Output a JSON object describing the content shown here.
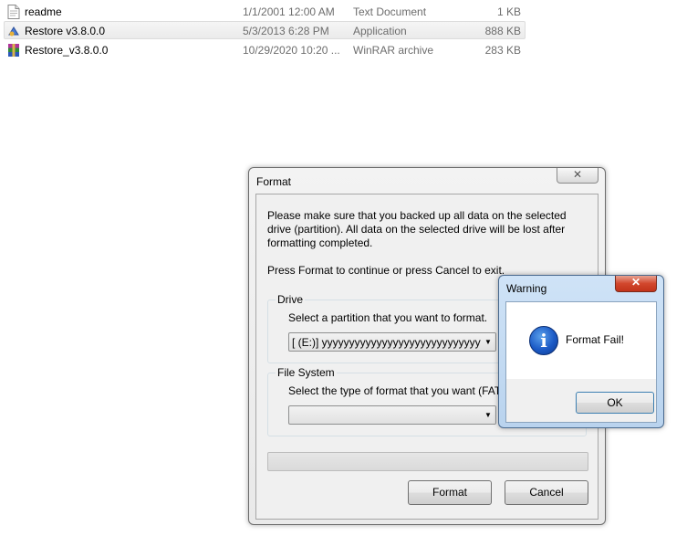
{
  "files": [
    {
      "name": "readme",
      "date": "1/1/2001 12:00 AM",
      "type": "Text Document",
      "size": "1 KB",
      "icon": "text-file-icon",
      "selected": false
    },
    {
      "name": "Restore v3.8.0.0",
      "date": "5/3/2013 6:28 PM",
      "type": "Application",
      "size": "888 KB",
      "icon": "application-icon",
      "selected": true
    },
    {
      "name": "Restore_v3.8.0.0",
      "date": "10/29/2020 10:20 ...",
      "type": "WinRAR archive",
      "size": "283 KB",
      "icon": "winrar-archive-icon",
      "selected": false
    }
  ],
  "format_dialog": {
    "title": "Format",
    "close_label": "✕",
    "message": "Please make sure that you backed up all data on the selected drive (partition).  All data on the selected drive will be lost after formatting completed.",
    "press_text": "Press Format to continue or press Cancel to exit.",
    "drive_group": {
      "legend": "Drive",
      "description": "Select a partition that you want to format.",
      "selected_value": "[ (E:)] yyyyyyyyyyyyyyyyyyyyyyyyyyyyyyyyy"
    },
    "fs_group": {
      "legend": "File System",
      "description": "Select the type of format that you want (FAT",
      "selected_value": ""
    },
    "progress_fraction": 0,
    "format_button": "Format",
    "cancel_button": "Cancel"
  },
  "warning_dialog": {
    "title": "Warning",
    "close_label": "✕",
    "message": "Format Fail!",
    "icon": "info-icon",
    "ok_button": "OK"
  }
}
